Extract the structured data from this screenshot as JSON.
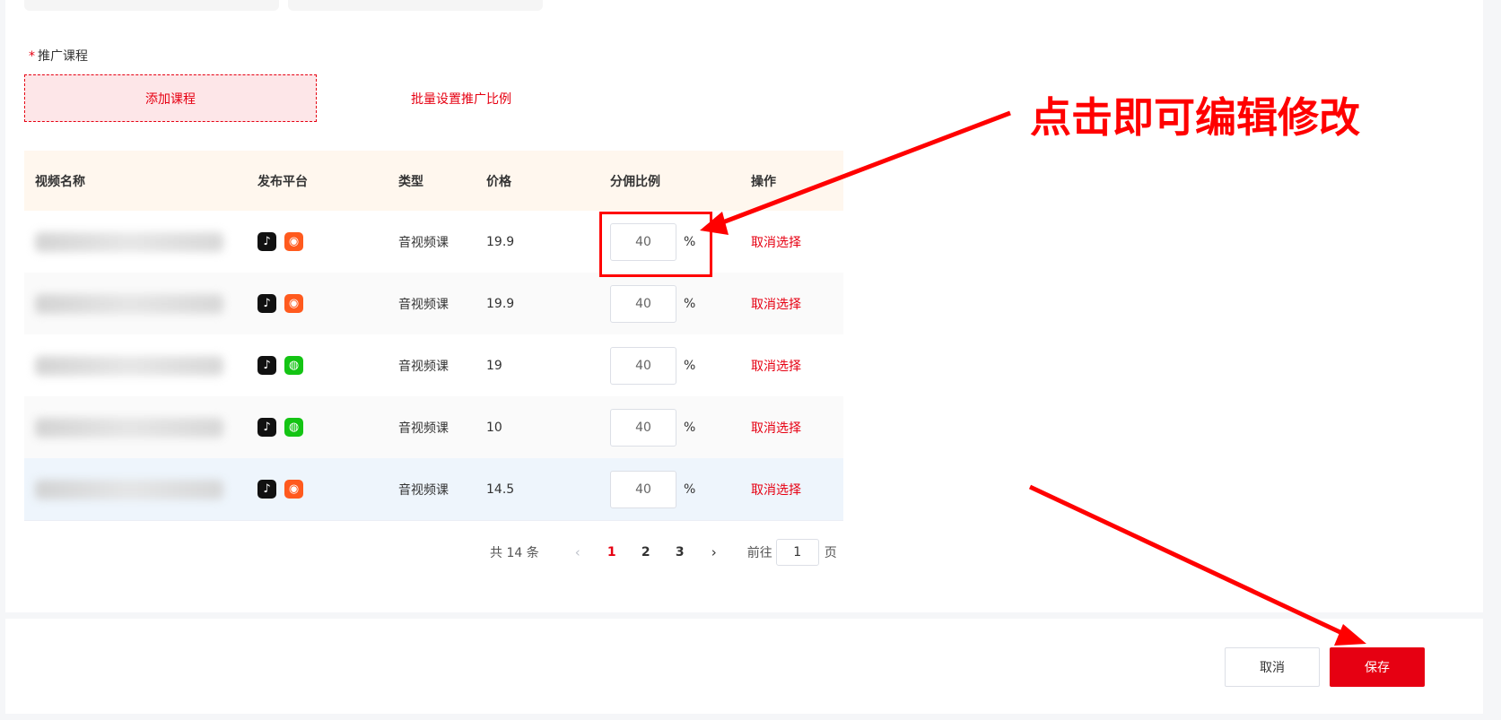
{
  "section": {
    "required_mark": "*",
    "label": "推广课程"
  },
  "actions": {
    "add_course": "添加课程",
    "batch_set_ratio": "批量设置推广比例"
  },
  "table": {
    "headers": {
      "name": "视频名称",
      "platform": "发布平台",
      "type": "类型",
      "price": "价格",
      "ratio": "分佣比例",
      "op": "操作"
    },
    "rows": [
      {
        "type": "音视频课",
        "price": "19.9",
        "ratio": "40",
        "unit": "%",
        "op": "取消选择",
        "platforms": [
          "douyin-icon",
          "kuaishou-icon"
        ]
      },
      {
        "type": "音视频课",
        "price": "19.9",
        "ratio": "40",
        "unit": "%",
        "op": "取消选择",
        "platforms": [
          "douyin-icon",
          "kuaishou-icon"
        ]
      },
      {
        "type": "音视频课",
        "price": "19",
        "ratio": "40",
        "unit": "%",
        "op": "取消选择",
        "platforms": [
          "douyin-icon",
          "wechat-icon"
        ]
      },
      {
        "type": "音视频课",
        "price": "10",
        "ratio": "40",
        "unit": "%",
        "op": "取消选择",
        "platforms": [
          "douyin-icon",
          "wechat-icon"
        ]
      },
      {
        "type": "音视频课",
        "price": "14.5",
        "ratio": "40",
        "unit": "%",
        "op": "取消选择",
        "platforms": [
          "douyin-icon",
          "kuaishou-icon"
        ]
      }
    ]
  },
  "pagination": {
    "total": "共 14 条",
    "pages": [
      "1",
      "2",
      "3"
    ],
    "current": "1",
    "goto_label": "前往",
    "goto_value": "1",
    "page_suffix": "页"
  },
  "footer": {
    "cancel": "取消",
    "save": "保存"
  },
  "annotation": {
    "text": "点击即可编辑修改",
    "color": "#ff0000"
  },
  "colors": {
    "accent": "#e60012",
    "header_bg": "#fff7ee"
  }
}
